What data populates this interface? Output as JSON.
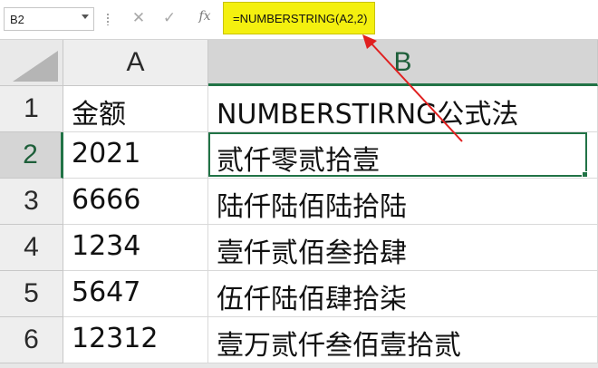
{
  "formula_bar": {
    "name_box": "B2",
    "formula": "=NUMBERSTRING(A2,2)"
  },
  "icons": {
    "cancel": "close-icon",
    "enter": "check-icon",
    "function": "fx-icon"
  },
  "grid": {
    "column_headers": [
      "A",
      "B"
    ],
    "row_headers": [
      "1",
      "2",
      "3",
      "4",
      "5",
      "6"
    ],
    "rows": [
      [
        "金额",
        "NUMBERSTIRNG公式法"
      ],
      [
        "2021",
        "贰仟零贰拾壹"
      ],
      [
        "6666",
        "陆仟陆佰陆拾陆"
      ],
      [
        "1234",
        "壹仟贰佰叁拾肆"
      ],
      [
        "5647",
        "伍仟陆佰肆拾柒"
      ],
      [
        "12312",
        "壹万贰仟叁佰壹拾贰"
      ]
    ],
    "active_cell": "B2"
  },
  "colors": {
    "formula_highlight": "#f4f00f",
    "selection": "#217346",
    "annotation_arrow": "#e02020"
  }
}
